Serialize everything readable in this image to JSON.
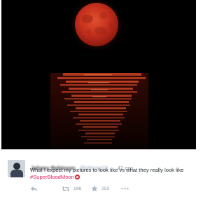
{
  "tweet": {
    "author_name": "Johnny Robinson",
    "author_handle": "@johnnyr23",
    "separator": "·",
    "timestamp": "42 min",
    "text": "What I expect my pictures to look like vs what they really look like",
    "hashtag": "#SuperBloodMoon",
    "stats": {
      "retweets": "196",
      "favorites": "253"
    }
  },
  "icons": {
    "reply": "reply-icon",
    "retweet": "retweet-icon",
    "favorite": "star-icon",
    "more": "more-dots-icon"
  },
  "colors": {
    "hashtag": "#e0245e",
    "moon": "#c8321c",
    "reflection": "#d94a2a",
    "meta_text": "#8899a6"
  }
}
